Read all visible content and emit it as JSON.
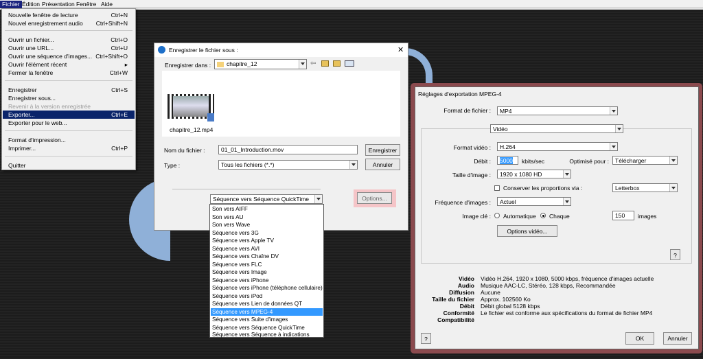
{
  "menubar": [
    "Fichier",
    "Édition",
    "Présentation",
    "Fenêtre",
    "Aide"
  ],
  "file_menu": {
    "g1": [
      {
        "label": "Nouvelle fenêtre de lecture",
        "sc": "Ctrl+N"
      },
      {
        "label": "Nouvel enregistrement audio",
        "sc": "Ctrl+Shift+N"
      }
    ],
    "g2": [
      {
        "label": "Ouvrir un fichier...",
        "sc": "Ctrl+O"
      },
      {
        "label": "Ouvrir une URL...",
        "sc": "Ctrl+U"
      },
      {
        "label": "Ouvrir une séquence d'images...",
        "sc": "Ctrl+Shift+O"
      },
      {
        "label": "Ouvrir l'élément récent",
        "sc": "▸"
      },
      {
        "label": "Fermer la fenêtre",
        "sc": "Ctrl+W"
      }
    ],
    "g3": [
      {
        "label": "Enregistrer",
        "sc": "Ctrl+S"
      },
      {
        "label": "Enregistrer sous...",
        "sc": ""
      },
      {
        "label": "Revenir à la version enregistrée",
        "sc": ""
      },
      {
        "label": "Exporter...",
        "sc": "Ctrl+E"
      },
      {
        "label": "Exporter pour le web...",
        "sc": ""
      }
    ],
    "g4": [
      {
        "label": "Format d'impression...",
        "sc": ""
      },
      {
        "label": "Imprimer...",
        "sc": "Ctrl+P"
      }
    ],
    "g5": [
      {
        "label": "Quitter",
        "sc": ""
      }
    ]
  },
  "save": {
    "title": "Enregistrer le fichier sous :",
    "save_in_label": "Enregistrer dans :",
    "folder": "chapitre_12",
    "file_thumb_label": "chapitre_12.mp4",
    "filename_label": "Nom du fichier :",
    "filename": "01_01_Introduction.mov",
    "type_label": "Type :",
    "type_value": "Tous les fichiers (*.*)",
    "save_btn": "Enregistrer",
    "cancel_btn": "Annuler",
    "export_select": "Séquence vers Séquence QuickTime",
    "options_btn": "Options...",
    "close": "✕"
  },
  "export_list": [
    "Son vers AIFF",
    "Son vers AU",
    "Son vers Wave",
    "Séquence vers 3G",
    "Séquence vers Apple TV",
    "Séquence vers AVI",
    "Séquence vers Chaîne DV",
    "Séquence vers FLC",
    "Séquence vers Image",
    "Séquence vers iPhone",
    "Séquence vers iPhone (téléphone cellulaire)",
    "Séquence vers iPod",
    "Séquence vers Lien de données QT",
    "Séquence vers MPEG-4",
    "Séquence vers Suite d'images",
    "Séquence vers Séquence QuickTime",
    "Séquence vers Séquence à indications"
  ],
  "mpeg": {
    "title": "Réglages d'exportation MPEG-4",
    "format_label": "Format de fichier :",
    "format": "MP4",
    "tab": "Vidéo",
    "video_format_label": "Format vidéo :",
    "video_format": "H.264",
    "bitrate_label": "Débit :",
    "bitrate": "5000",
    "bitrate_unit": "kbits/sec",
    "optimize_label": "Optimisé pour :",
    "optimize": "Télécharger",
    "size_label": "Taille d'image :",
    "size": "1920 x 1080 HD",
    "keep_prop_label": "Conserver les proportions via :",
    "letterbox": "Letterbox",
    "fps_label": "Fréquence d'images :",
    "fps": "Actuel",
    "keyframe_label": "Image clé :",
    "auto_label": "Automatique",
    "every_label": "Chaque",
    "every_value": "150",
    "images_label": "images",
    "video_options_btn": "Options vidéo...",
    "help": "?",
    "summary": [
      {
        "k": "Vidéo",
        "v": "Vidéo H.264, 1920 x 1080, 5000 kbps, fréquence d'images actuelle"
      },
      {
        "k": "Audio",
        "v": "Musique AAC-LC, Stéréo, 128 kbps, Recommandée"
      },
      {
        "k": "Diffusion",
        "v": "Aucune"
      },
      {
        "k": "Taille du fichier",
        "v": "Approx. 102560 Ko"
      },
      {
        "k": "Débit",
        "v": "Débit global 5128 kbps"
      },
      {
        "k": "Conformité",
        "v": "Le fichier est conforme aux spécifications du format de fichier MP4"
      },
      {
        "k": "Compatibilité",
        "v": ""
      }
    ],
    "ok_btn": "OK",
    "cancel_btn": "Annuler"
  },
  "colors": {
    "menu_highlight": "#0a246a",
    "list_highlight": "#3399ff",
    "frame": "#8b4a4e",
    "options_btn_bg": "#f5c5c8"
  }
}
